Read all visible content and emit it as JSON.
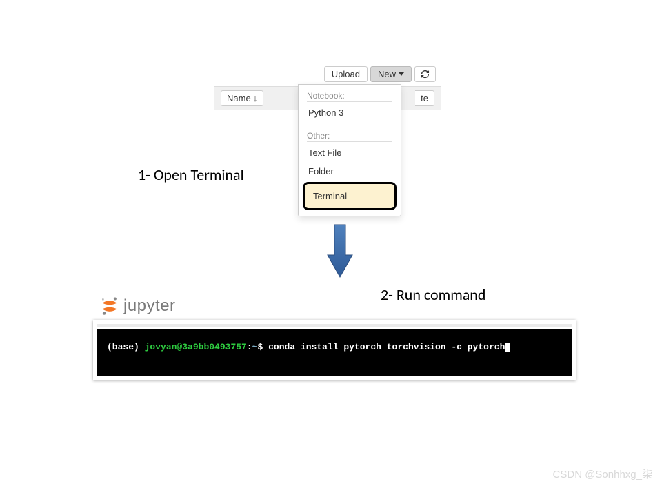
{
  "jupyter": {
    "toolbar": {
      "upload_label": "Upload",
      "new_label": "New"
    },
    "list_header": {
      "name_label": "Name",
      "right_frag": "te"
    },
    "dropdown": {
      "notebook_header": "Notebook:",
      "python3": "Python 3",
      "other_header": "Other:",
      "textfile": "Text File",
      "folder": "Folder",
      "terminal": "Terminal"
    },
    "logo_text": "jupyter"
  },
  "steps": {
    "one": "1- Open Terminal",
    "two": "2- Run command"
  },
  "terminal": {
    "env": "(base)",
    "host": "jovyan@3a9bb0493757",
    "colon": ":",
    "path": "~",
    "dollar": "$",
    "command": "conda install pytorch torchvision -c pytorch"
  },
  "watermark": "CSDN @Sonhhxg_柒"
}
